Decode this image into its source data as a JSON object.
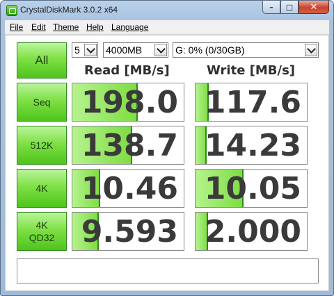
{
  "window": {
    "title": "CrystalDiskMark 3.0.2 x64",
    "controls": {
      "minimize": "–",
      "maximize": "□",
      "close": "✕"
    }
  },
  "menu": [
    "File",
    "Edit",
    "Theme",
    "Help",
    "Language"
  ],
  "controls": {
    "all_label": "All",
    "runs": "5",
    "size": "4000MB",
    "drive": "G: 0% (0/30GB)"
  },
  "headers": {
    "read": "Read [MB/s]",
    "write": "Write [MB/s]"
  },
  "tests": [
    {
      "label": [
        "Seq"
      ],
      "read": "198.0",
      "write": "117.6",
      "read_fill": 0.59,
      "write_fill": 0.12
    },
    {
      "label": [
        "512K"
      ],
      "read": "138.7",
      "write": "14.23",
      "read_fill": 0.54,
      "write_fill": 0.1
    },
    {
      "label": [
        "4K"
      ],
      "read": "10.46",
      "write": "10.05",
      "read_fill": 0.25,
      "write_fill": 0.43
    },
    {
      "label": [
        "4K",
        "QD32"
      ],
      "read": "9.593",
      "write": "2.000",
      "read_fill": 0.24,
      "write_fill": 0.11
    }
  ],
  "status_text": "",
  "colors": {
    "accent_green": "#7ddc42",
    "button_border": "#2f8a1c",
    "title_blue": "#b9d1ea"
  }
}
